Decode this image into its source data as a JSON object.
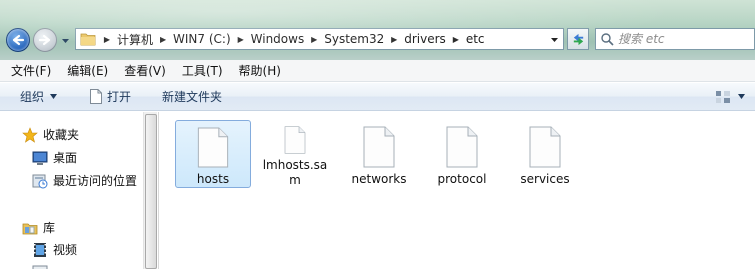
{
  "address_bar": {
    "crumbs": [
      "计算机",
      "WIN7 (C:)",
      "Windows",
      "System32",
      "drivers",
      "etc"
    ]
  },
  "search": {
    "placeholder": "搜索 etc"
  },
  "menu": {
    "items": [
      "文件(F)",
      "编辑(E)",
      "查看(V)",
      "工具(T)",
      "帮助(H)"
    ]
  },
  "commands": {
    "organize": "组织",
    "open": "打开",
    "new_folder": "新建文件夹"
  },
  "nav_pane": {
    "favorites": "收藏夹",
    "desktop": "桌面",
    "recent": "最近访问的位置",
    "libraries": "库",
    "videos": "视频"
  },
  "files": [
    {
      "name": "hosts",
      "selected": true
    },
    {
      "name": "lmhosts.sa\nm",
      "selected": false
    },
    {
      "name": "networks",
      "selected": false
    },
    {
      "name": "protocol",
      "selected": false
    },
    {
      "name": "services",
      "selected": false
    }
  ],
  "colors": {
    "accent": "#1f5fb8",
    "selection_bg": "#cde8fb",
    "selection_border": "#84acdd"
  }
}
